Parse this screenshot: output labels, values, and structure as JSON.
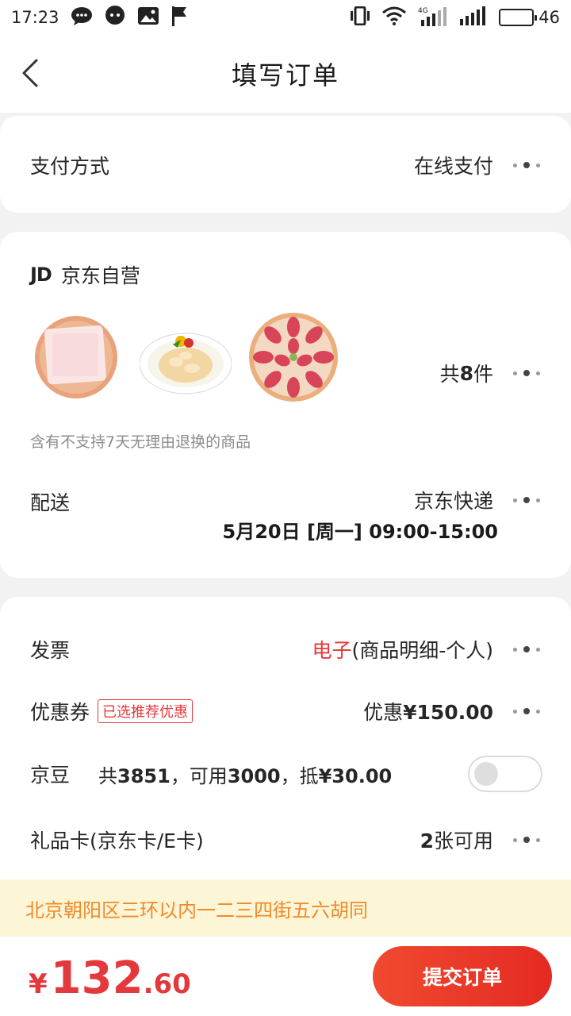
{
  "status_bar": {
    "time": "17:23",
    "network": "4G",
    "battery": "46"
  },
  "nav": {
    "title": "填写订单"
  },
  "payment": {
    "label": "支付方式",
    "value": "在线支付"
  },
  "shop": {
    "logo_text": "JD",
    "name": "京东自营",
    "item_count_prefix": "共",
    "item_count": "8",
    "item_count_suffix": "件",
    "products": [
      "rice-cake-icon",
      "squid-salad-icon",
      "sausage-platter-icon"
    ],
    "notice": "含有不支持7天无理由退换的商品"
  },
  "delivery": {
    "label": "配送",
    "method": "京东快递",
    "time": "5月20日 [周一] 09:00-15:00"
  },
  "invoice": {
    "label": "发票",
    "type": "电子",
    "detail": "(商品明细-个人)"
  },
  "coupon": {
    "label": "优惠券",
    "tag": "已选推荐优惠",
    "value_prefix": "优惠",
    "value": "¥150.00"
  },
  "beans": {
    "label": "京豆",
    "text_1": "共",
    "total": "3851",
    "text_2": "，可用",
    "usable": "3000",
    "text_3": "，抵",
    "deduct": "¥30.00",
    "enabled": false
  },
  "gift_card": {
    "label": "礼品卡(京东卡/E卡)",
    "count": "2",
    "count_suffix": "张可用"
  },
  "address": "北京朝阳区三环以内一二三四街五六胡同",
  "footer": {
    "currency": "¥",
    "price_int": "132",
    "price_dec": ".60",
    "submit_label": "提交订单"
  },
  "colors": {
    "accent": "#e4393c",
    "address_text": "#f08a2b",
    "address_bg": "#fcf6d6"
  }
}
